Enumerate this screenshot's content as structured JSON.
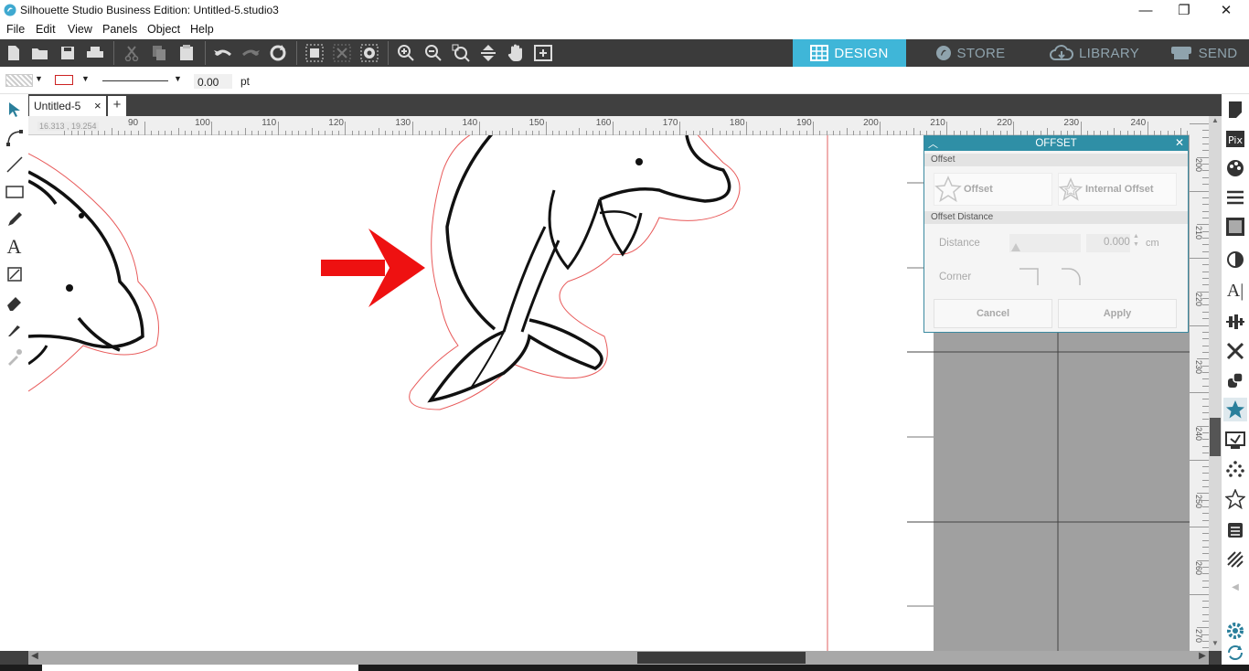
{
  "window": {
    "title": "Silhouette Studio Business Edition: Untitled-5.studio3",
    "minimize": "—",
    "restore": "❐",
    "close": "✕"
  },
  "menu": [
    "File",
    "Edit",
    "View",
    "Panels",
    "Object",
    "Help"
  ],
  "nav_tabs": {
    "design": "DESIGN",
    "store": "STORE",
    "library": "LIBRARY",
    "send": "SEND",
    "active_color": "#3fb6d8"
  },
  "properties": {
    "line_width": "0.00",
    "unit": "pt",
    "line_color": "#cc2222"
  },
  "document_tab": {
    "name": "Untitled-5",
    "close": "×",
    "add": "+"
  },
  "ruler": {
    "coords": "16.313 , 19.254",
    "h_labels": [
      "90",
      "100",
      "110",
      "120",
      "130",
      "140",
      "150",
      "160",
      "170",
      "180",
      "190",
      "200",
      "210",
      "220",
      "230",
      "240"
    ],
    "v_labels": [
      "200",
      "210",
      "220",
      "230",
      "240",
      "250",
      "260",
      "270"
    ]
  },
  "offset_panel": {
    "title": "OFFSET",
    "section_offset": "Offset",
    "offset_button": "Offset",
    "internal_offset_button": "Internal Offset",
    "section_distance": "Offset Distance",
    "distance_label": "Distance",
    "distance_value": "0.000",
    "distance_unit": "cm",
    "corner_label": "Corner",
    "cancel_button": "Cancel",
    "apply_button": "Apply"
  },
  "colors": {
    "toolbar_bg": "#3b3b3b",
    "panel_header": "#2f8fa6",
    "arrow": "#ee1111",
    "offset_line": "#e85a5a",
    "icon_teal": "#2a7f9b"
  }
}
